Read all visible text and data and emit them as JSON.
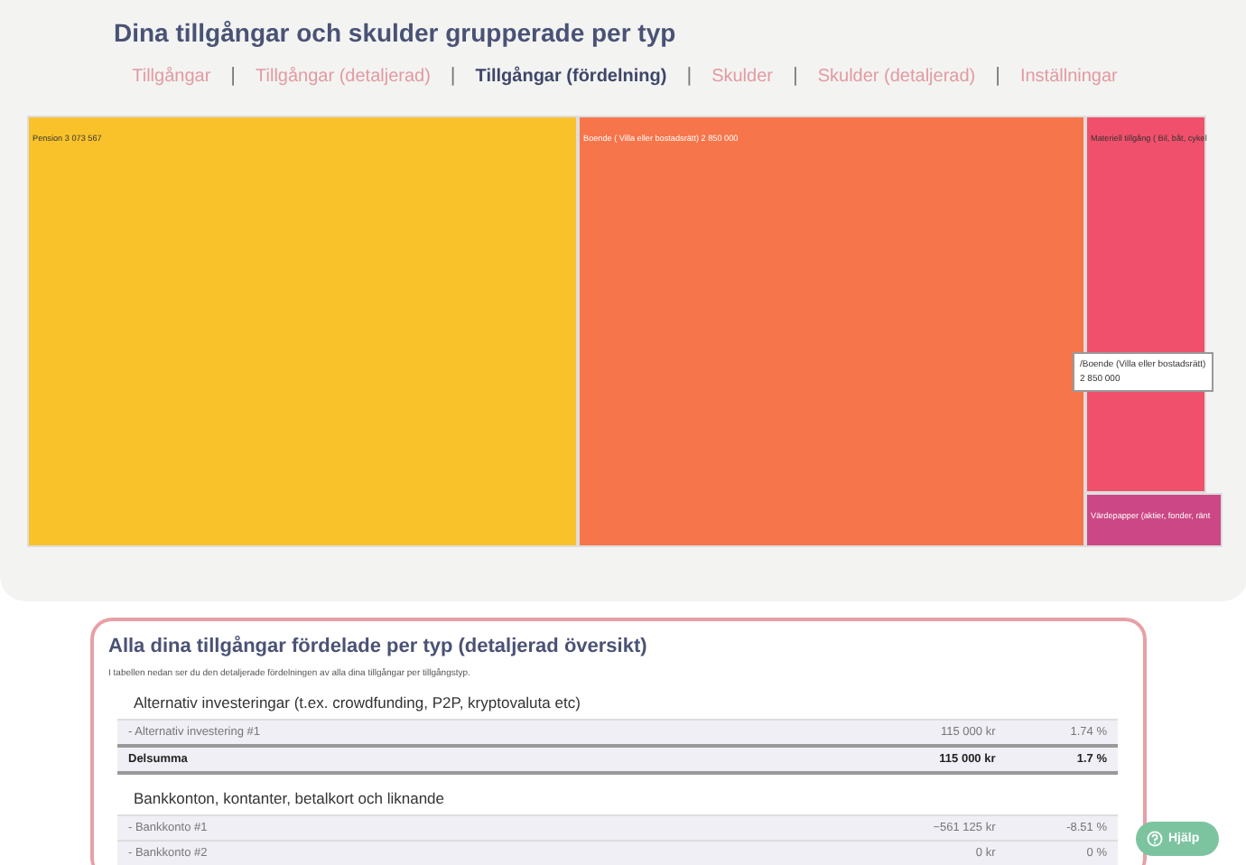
{
  "title": "Dina tillgångar och skulder grupperade per typ",
  "tab_separator": "|",
  "tabs": [
    {
      "label": "Tillgångar",
      "selected": false
    },
    {
      "label": "Tillgångar (detaljerad)",
      "selected": false
    },
    {
      "label": "Tillgångar (fördelning)",
      "selected": true
    },
    {
      "label": "Skulder",
      "selected": false
    },
    {
      "label": "Skulder (detaljerad)",
      "selected": false
    },
    {
      "label": "Inställningar",
      "selected": false
    }
  ],
  "treemap": {
    "tiles": [
      {
        "label": "Pension 3 073 567",
        "color": "#f9c22b"
      },
      {
        "label": "Boende ( Villa eller bostadsrätt) 2 850 000",
        "color": "#f7754a"
      },
      {
        "label": "Materiell tillgång ( Bil, båt, cykel",
        "color": "#f0506b"
      },
      {
        "label": "Värdepapper (aktier, fonder, ränt",
        "color": "#cc4785"
      }
    ],
    "tooltip": {
      "lines": [
        "/Boende (Villa eller bostadsrätt)",
        "2 850 000"
      ]
    }
  },
  "card": {
    "title": "Alla dina tillgångar fördelade per typ (detaljerad översikt)",
    "intro": "I tabellen nedan ser du den detaljerade fördelningen av alla dina tillgångar per tillgångstyp.",
    "groups": [
      {
        "heading": "Alternativ investeringar (t.ex. crowdfunding, P2P, kryptovaluta etc)",
        "rows": [
          {
            "kind": "item",
            "name": "- Alternativ investering #1",
            "amount": "115 000 kr",
            "share": "1.74 %"
          },
          {
            "kind": "subtotal",
            "name": "Delsumma",
            "amount": "115 000 kr",
            "share": "1.7 %"
          }
        ]
      },
      {
        "heading": "Bankkonton, kontanter, betalkort och liknande",
        "rows": [
          {
            "kind": "item",
            "name": "- Bankkonto #1",
            "amount": "−561 125 kr",
            "share": "-8.51 %"
          },
          {
            "kind": "item",
            "name": "- Bankkonto #2",
            "amount": "0 kr",
            "share": "0 %"
          }
        ]
      }
    ]
  },
  "help": {
    "label": "Hjälp"
  }
}
